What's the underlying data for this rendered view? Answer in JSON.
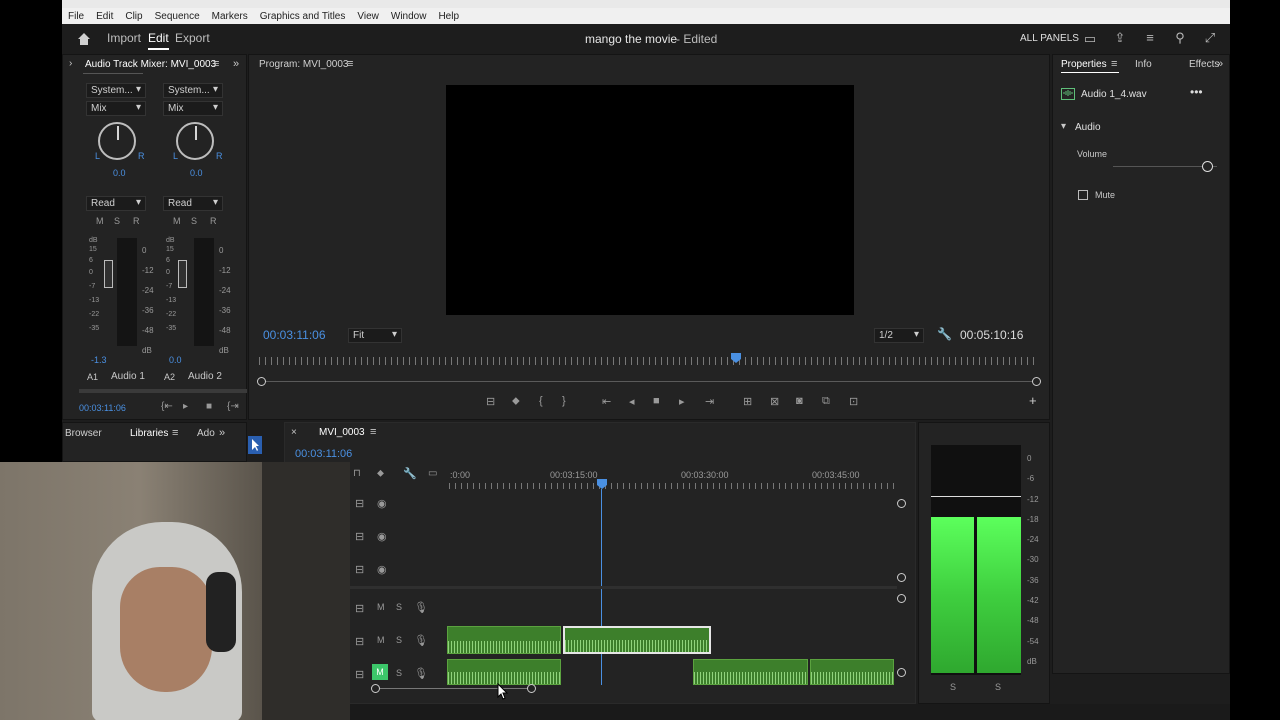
{
  "menu": [
    "File",
    "Edit",
    "Clip",
    "Sequence",
    "Markers",
    "Graphics and Titles",
    "View",
    "Window",
    "Help"
  ],
  "header": {
    "tabs": [
      "Import",
      "Edit",
      "Export"
    ],
    "active_tab": "Edit",
    "project_title": "mango the movie",
    "project_status": "- Edited",
    "all_panels": "ALL PANELS"
  },
  "mixer": {
    "title": "Audio Track Mixer: MVI_0003",
    "channels": [
      {
        "input": "System...",
        "mode": "Mix",
        "pan": "0.0",
        "automation": "Read",
        "level": "-1.3",
        "track_id": "A1",
        "track_name": "Audio 1"
      },
      {
        "input": "System...",
        "mode": "Mix",
        "pan": "0.0",
        "automation": "Read",
        "level": "0.0",
        "track_id": "A2",
        "track_name": "Audio 2"
      }
    ],
    "db_scale": [
      "0",
      "-12",
      "-24",
      "-36",
      "-48",
      "dB"
    ],
    "fader_scale": [
      "dB",
      "15",
      "6",
      "0",
      "-7",
      "-13",
      "-22",
      "-35"
    ],
    "msr": [
      "M",
      "S",
      "R"
    ],
    "timecode": "00:03:11:06"
  },
  "program": {
    "title": "Program: MVI_0003",
    "timecode": "00:03:11:06",
    "fit": "Fit",
    "resolution": "1/2",
    "duration": "00:05:10:16"
  },
  "lower_left_tabs": [
    "Browser",
    "Libraries",
    "Ado"
  ],
  "timeline": {
    "sequence": "MVI_0003",
    "timecode": "00:03:11:06",
    "ruler_labels": [
      ":0:00",
      "00:03:15:00",
      "00:03:30:00",
      "00:03:45:00"
    ]
  },
  "audio_meter": {
    "scale": [
      "0",
      "-6",
      "-12",
      "-18",
      "-24",
      "-30",
      "-36",
      "-42",
      "-48",
      "-54",
      "dB"
    ],
    "channels": [
      "S",
      "S"
    ],
    "level_fraction": 0.78
  },
  "properties": {
    "tabs": [
      "Properties",
      "Info",
      "Effects"
    ],
    "file": "Audio 1_4.wav",
    "section": "Audio",
    "volume_label": "Volume",
    "mute_label": "Mute",
    "volume_fraction": 0.9
  }
}
